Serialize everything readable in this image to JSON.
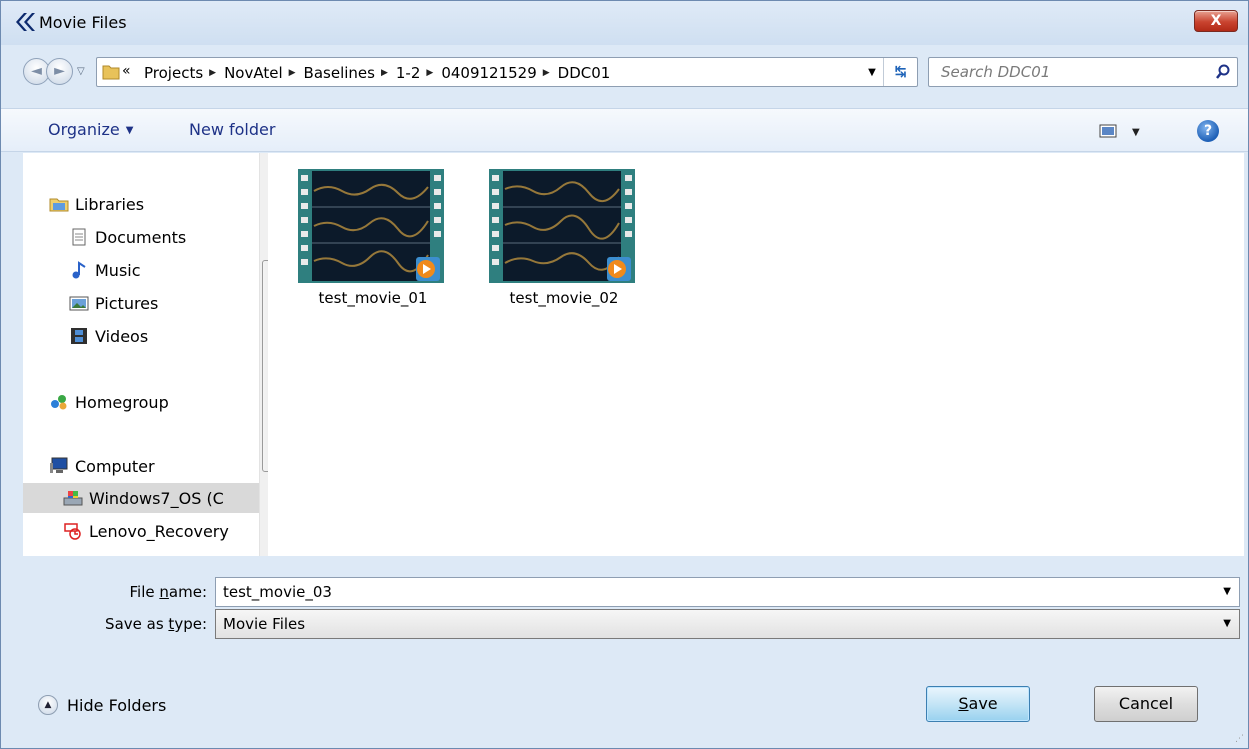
{
  "window": {
    "title": "Movie Files",
    "close_label": "X"
  },
  "nav": {
    "back_glyph": "◄",
    "forward_glyph": "►",
    "recent_glyph": "▽",
    "path_prefix": "«",
    "breadcrumbs": [
      "Projects",
      "NovAtel",
      "Baselines",
      "1-2",
      "0409121529",
      "DDC01"
    ],
    "crumb_separator": "▶",
    "refresh_glyph": "↹",
    "search_placeholder": "Search DDC01"
  },
  "toolbar": {
    "organize": "Organize",
    "new_folder": "New folder",
    "help": "?"
  },
  "sidebar": {
    "items": [
      {
        "label": "Libraries",
        "icon": "libraries-icon"
      },
      {
        "label": "Documents",
        "icon": "documents-icon"
      },
      {
        "label": "Music",
        "icon": "music-icon"
      },
      {
        "label": "Pictures",
        "icon": "pictures-icon"
      },
      {
        "label": "Videos",
        "icon": "videos-icon"
      },
      {
        "label": "Homegroup",
        "icon": "homegroup-icon"
      },
      {
        "label": "Computer",
        "icon": "computer-icon"
      },
      {
        "label": "Windows7_OS (C",
        "icon": "drive-icon",
        "selected": true
      },
      {
        "label": "Lenovo_Recovery",
        "icon": "recovery-drive-icon"
      }
    ]
  },
  "files": [
    {
      "name": "test_movie_01"
    },
    {
      "name": "test_movie_02"
    }
  ],
  "form": {
    "file_name_label_pre": "File ",
    "file_name_label_ul": "n",
    "file_name_label_post": "ame:",
    "file_name_value": "test_movie_03",
    "type_label_pre": "Save as ",
    "type_label_ul": "t",
    "type_label_post": "ype:",
    "type_value": "Movie Files"
  },
  "footer": {
    "hide_folders": "Hide Folders",
    "save_ul": "S",
    "save_rest": "ave",
    "cancel": "Cancel"
  },
  "colors": {
    "accent": "#1e3287",
    "close": "#c9432f",
    "window_bg": "#dde9f6"
  }
}
